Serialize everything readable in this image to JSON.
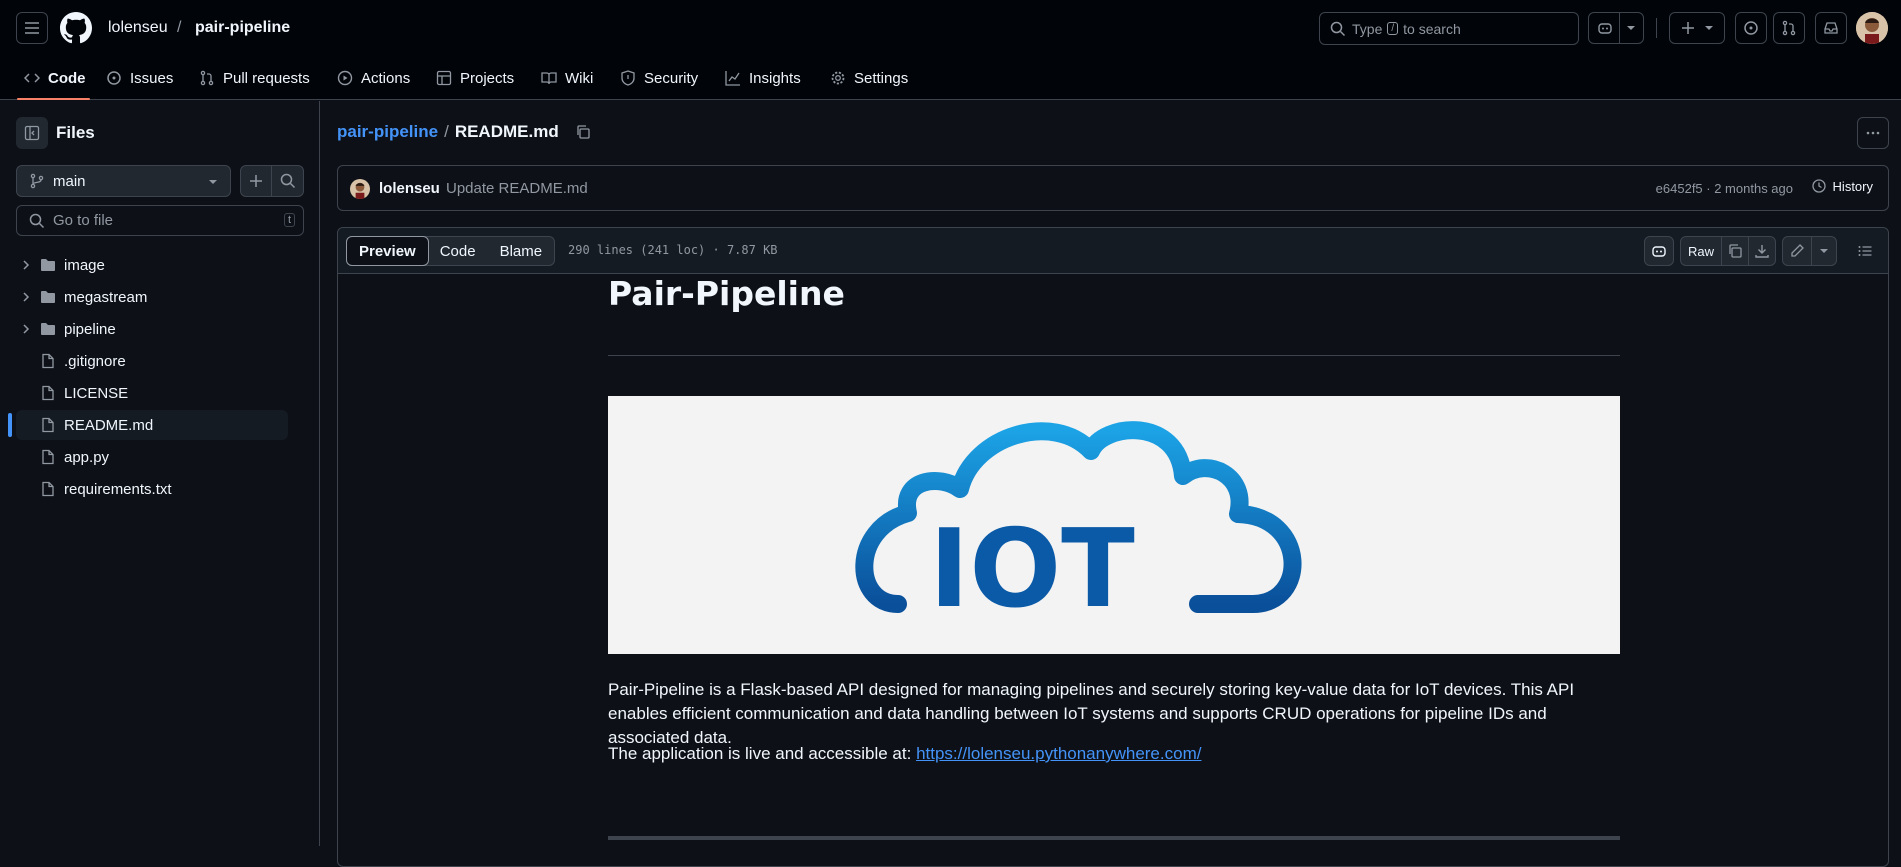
{
  "header": {
    "owner": "lolenseu",
    "separator": "/",
    "repo": "pair-pipeline",
    "search_prefix": "Type",
    "search_key": "/",
    "search_suffix": "to search"
  },
  "nav": {
    "tabs": [
      {
        "label": "Code",
        "icon": "code-icon"
      },
      {
        "label": "Issues",
        "icon": "issue-icon"
      },
      {
        "label": "Pull requests",
        "icon": "pull-request-icon"
      },
      {
        "label": "Actions",
        "icon": "play-icon"
      },
      {
        "label": "Projects",
        "icon": "table-icon"
      },
      {
        "label": "Wiki",
        "icon": "book-icon"
      },
      {
        "label": "Security",
        "icon": "shield-icon"
      },
      {
        "label": "Insights",
        "icon": "graph-icon"
      },
      {
        "label": "Settings",
        "icon": "gear-icon"
      }
    ]
  },
  "sidebar": {
    "title": "Files",
    "branch": "main",
    "goto_placeholder": "Go to file",
    "goto_key": "t",
    "items": [
      {
        "label": "image",
        "type": "folder"
      },
      {
        "label": "megastream",
        "type": "folder"
      },
      {
        "label": "pipeline",
        "type": "folder"
      },
      {
        "label": ".gitignore",
        "type": "file"
      },
      {
        "label": "LICENSE",
        "type": "file"
      },
      {
        "label": "README.md",
        "type": "file",
        "active": true
      },
      {
        "label": "app.py",
        "type": "file"
      },
      {
        "label": "requirements.txt",
        "type": "file"
      }
    ]
  },
  "file": {
    "repo_link": "pair-pipeline",
    "separator": "/",
    "name": "README.md",
    "commit_author": "lolenseu",
    "commit_message": "Update README.md",
    "commit_meta": "e6452f5 · 2 months ago",
    "history_label": "History",
    "view_tabs": [
      "Preview",
      "Code",
      "Blame"
    ],
    "stats": "290 lines (241 loc) · 7.87 KB",
    "raw_label": "Raw"
  },
  "readme": {
    "title": "Pair-Pipeline",
    "image_text": "IOT",
    "para1": "Pair-Pipeline is a Flask-based API designed for managing pipelines and securely storing key-value data for IoT devices. This API enables efficient communication and data handling between IoT systems and supports CRUD operations for pipeline IDs and associated data.",
    "para2_prefix": "The application is live and accessible at: ",
    "para2_link": "https://lolenseu.pythonanywhere.com/"
  },
  "colors": {
    "bg": "#0d1117",
    "header_bg": "#010409",
    "border": "#3d444d",
    "accent": "#4493f8",
    "tab_underline": "#f78166",
    "iot_blue": "#0a5aa8"
  }
}
